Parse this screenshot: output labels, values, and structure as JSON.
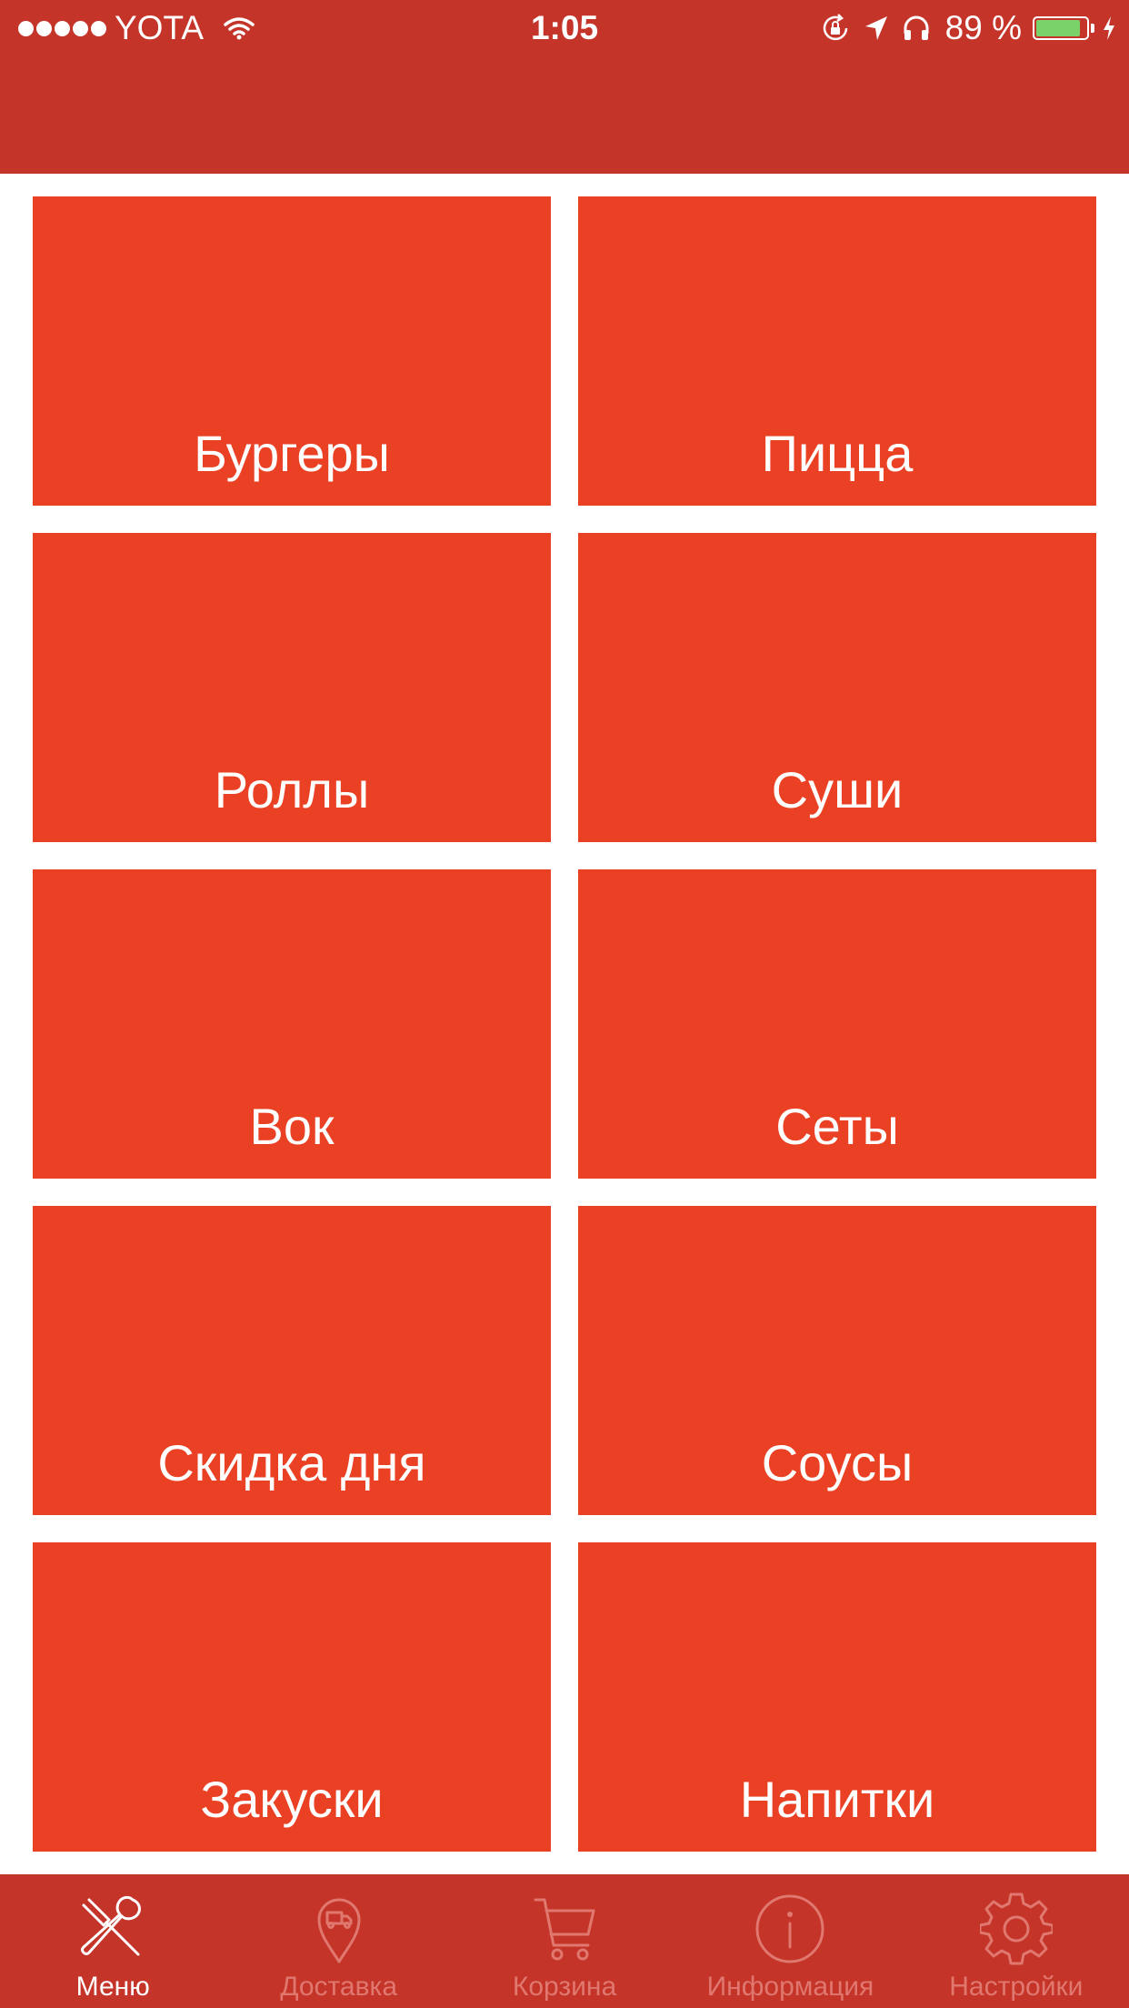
{
  "status_bar": {
    "carrier": "YOTA",
    "time": "1:05",
    "battery_percent": "89 %",
    "battery_level": 0.89,
    "icons": [
      "signal-dots",
      "wifi-icon",
      "rotation-lock-icon",
      "location-arrow-icon",
      "headphones-icon",
      "battery-icon",
      "charging-bolt-icon"
    ]
  },
  "colors": {
    "header": "#c43428",
    "tile": "#ea4124",
    "tabbar": "#c43428",
    "tab_active": "#ffffff",
    "tab_inactive": "#e07870",
    "battery_fill": "#7ad36a"
  },
  "categories": [
    {
      "label": "Бургеры"
    },
    {
      "label": "Пицца"
    },
    {
      "label": "Роллы"
    },
    {
      "label": "Суши"
    },
    {
      "label": "Вок"
    },
    {
      "label": "Сеты"
    },
    {
      "label": "Скидка дня"
    },
    {
      "label": "Соусы"
    },
    {
      "label": "Закуски"
    },
    {
      "label": "Напитки"
    }
  ],
  "tabbar": {
    "active_index": 0,
    "tabs": [
      {
        "label": "Меню",
        "icon": "fork-spoon-icon"
      },
      {
        "label": "Доставка",
        "icon": "delivery-pin-icon"
      },
      {
        "label": "Корзина",
        "icon": "cart-icon"
      },
      {
        "label": "Информация",
        "icon": "info-icon"
      },
      {
        "label": "Настройки",
        "icon": "gear-icon"
      }
    ]
  }
}
